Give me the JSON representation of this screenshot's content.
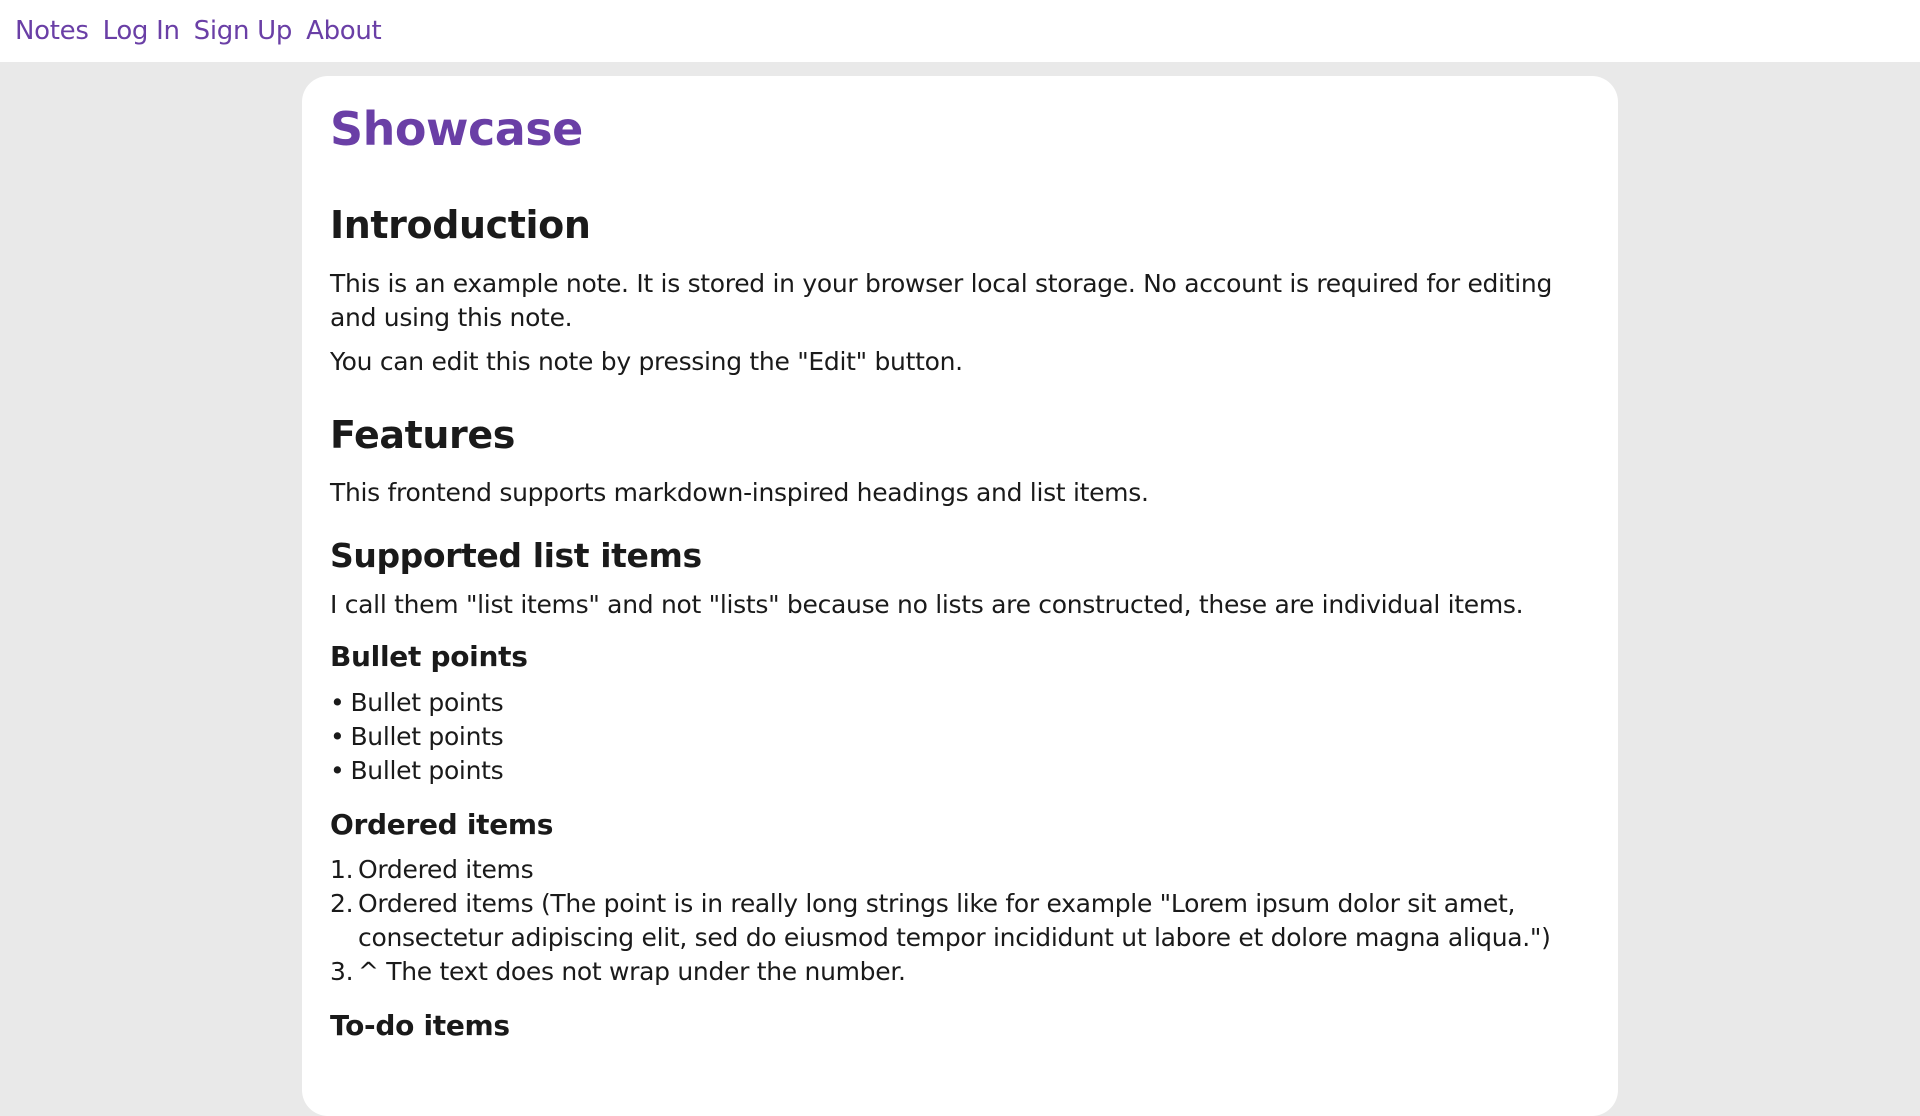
{
  "nav": {
    "links": [
      "Notes",
      "Log In",
      "Sign Up",
      "About"
    ]
  },
  "note": {
    "title": "Showcase",
    "introduction": {
      "heading": "Introduction",
      "p1": "This is an example note. It is stored in your browser local storage. No account is required for editing and using this note.",
      "p2": "You can edit this note by pressing the \"Edit\" button."
    },
    "features": {
      "heading": "Features",
      "p1": "This frontend supports markdown-inspired headings and list items.",
      "supported_heading": "Supported list items",
      "supported_p": "I call them \"list items\" and not \"lists\" because no lists are constructed, these are individual items.",
      "bullets_heading": "Bullet points",
      "bullets": [
        "Bullet points",
        "Bullet points",
        "Bullet points"
      ],
      "ordered_heading": "Ordered items",
      "ordered": [
        {
          "num": "1.",
          "text": "Ordered items"
        },
        {
          "num": "2.",
          "text": "Ordered items (The point is in really long strings like for example \"Lorem ipsum dolor sit amet, consectetur adipiscing elit, sed do eiusmod tempor incididunt ut labore et dolore magna aliqua.\")"
        },
        {
          "num": "3.",
          "text": "^ The text does not wrap under the number."
        }
      ],
      "todo_heading": "To-do items"
    }
  },
  "colors": {
    "accent": "#6a3fa6",
    "background": "#e9e9e9",
    "card": "#ffffff"
  }
}
